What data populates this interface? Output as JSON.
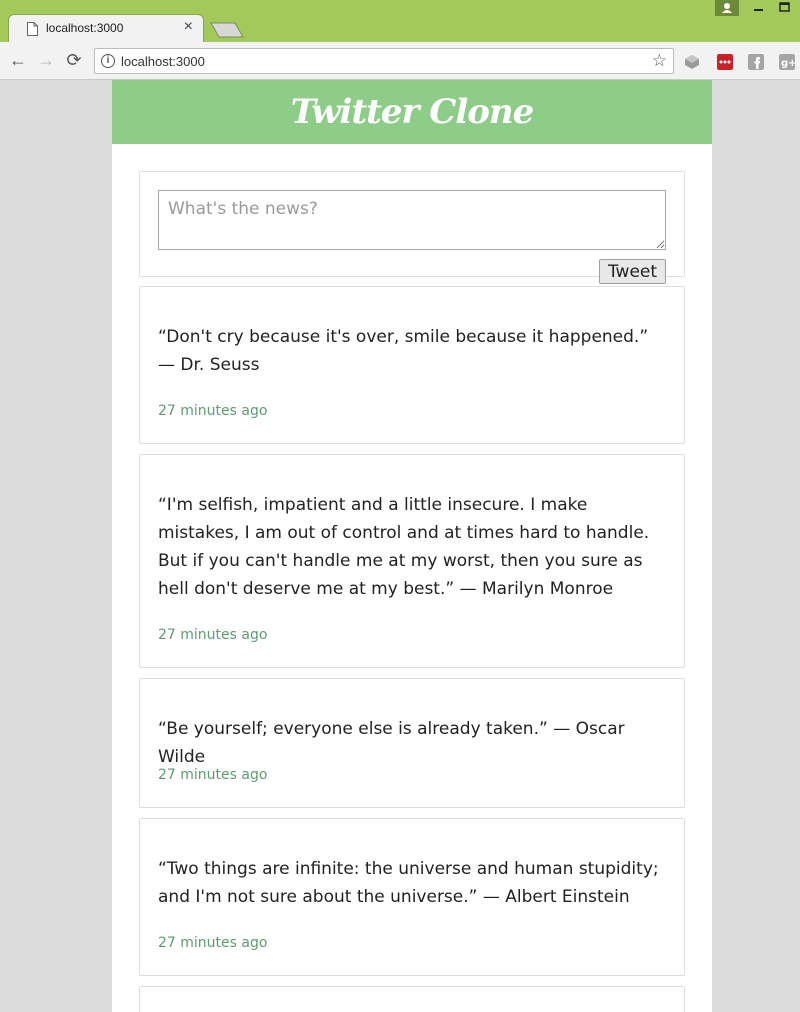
{
  "browser": {
    "tab_title": "localhost:3000",
    "tab_close": "×",
    "url": "localhost:3000",
    "back": "←",
    "forward": "→",
    "reload": "⟳",
    "star": "☆",
    "info": "i"
  },
  "app": {
    "title": "Twitter Clone",
    "composer": {
      "placeholder": "What's the news?",
      "button_label": "Tweet"
    }
  },
  "tweets": [
    {
      "text": "“Don't cry because it's over, smile because it happened.” — Dr. Seuss",
      "time": "27 minutes ago"
    },
    {
      "text": "“I'm selfish, impatient and a little insecure. I make mistakes, I am out of control and at times hard to handle. But if you can't handle me at my worst, then you sure as hell don't deserve me at my best.” — Marilyn Monroe",
      "time": "27 minutes ago"
    },
    {
      "text": "“Be yourself; everyone else is already taken.” — Oscar Wilde",
      "time": "27 minutes ago"
    },
    {
      "text": "“Two things are infinite: the universe and human stupidity; and I'm not sure about the universe.” — Albert Einstein",
      "time": "27 minutes ago"
    }
  ],
  "colors": {
    "header_bg": "#8dcd87",
    "titlebar": "#a3c95a",
    "timestamp": "#5a9e6f"
  }
}
